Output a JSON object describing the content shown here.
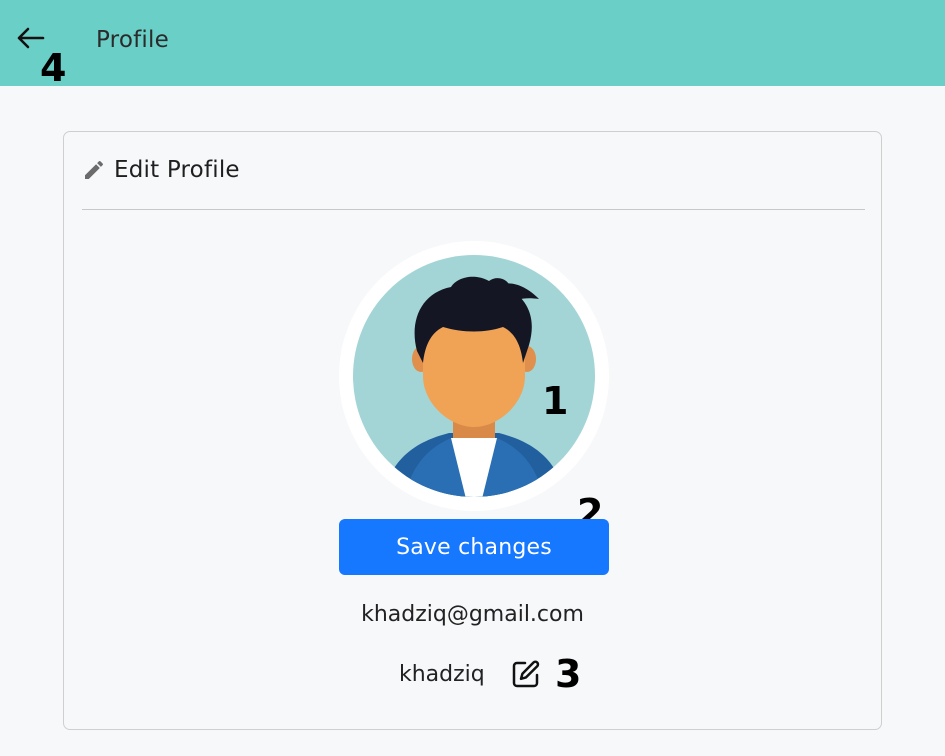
{
  "header": {
    "title": "Profile",
    "back_icon": "arrow-left-icon",
    "background_color": "#6acfc7"
  },
  "card": {
    "heading": "Edit Profile",
    "heading_icon": "pencil-icon"
  },
  "profile": {
    "avatar_icon": "person-avatar-illustration",
    "save_label": "Save changes",
    "email": "khadziq@gmail.com",
    "username": "khadziq",
    "edit_username_icon": "edit-square-icon"
  },
  "annotations": {
    "avatar_marker": "1",
    "save_marker": "2",
    "edit_marker": "3",
    "back_marker": "4"
  },
  "colors": {
    "accent": "#1677ff",
    "header": "#6acfc7",
    "avatar_bg": "#a3d5d6"
  }
}
